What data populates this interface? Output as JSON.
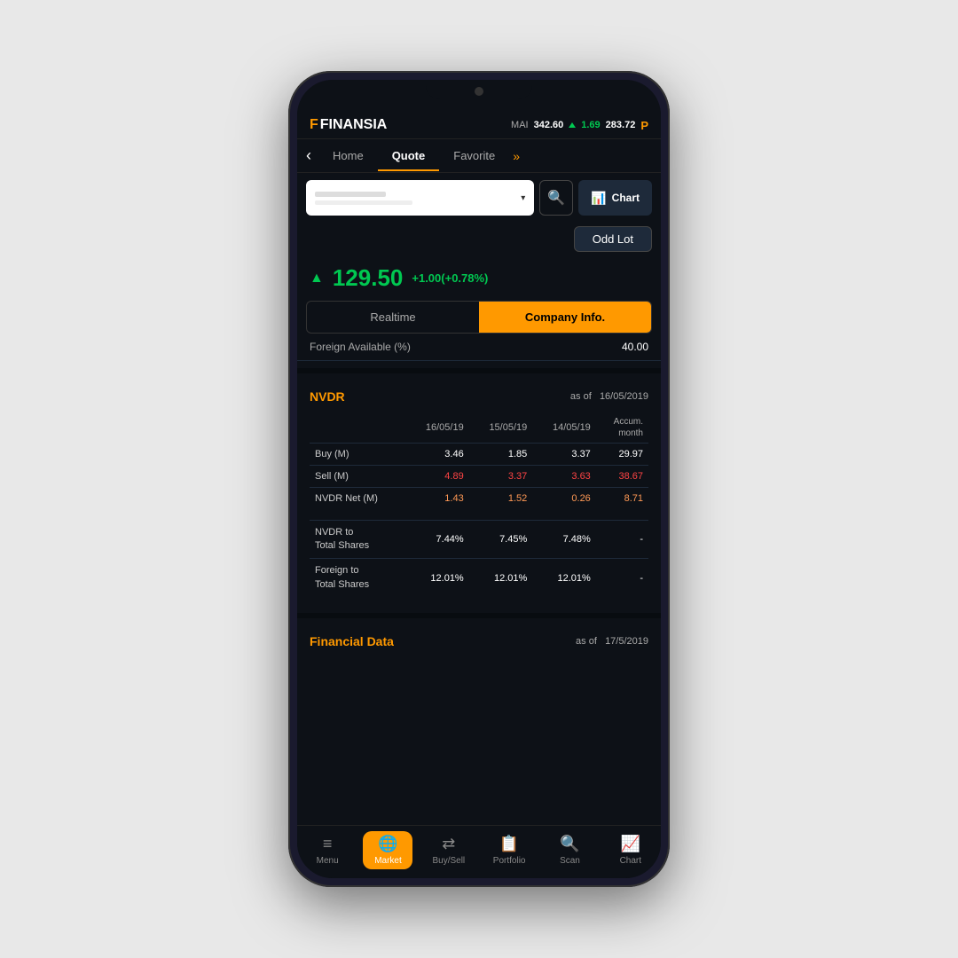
{
  "app": {
    "logo": "FINANSIA",
    "logo_f": "F"
  },
  "market_info": {
    "label": "MAI",
    "value": "342.60",
    "change": "1.69",
    "second_value": "283.72",
    "profile_letter": "P"
  },
  "nav": {
    "back_label": "‹",
    "tabs": [
      {
        "id": "home",
        "label": "Home",
        "active": false
      },
      {
        "id": "quote",
        "label": "Quote",
        "active": true
      },
      {
        "id": "favorite",
        "label": "Favorite",
        "active": false
      }
    ],
    "more_icon": "»"
  },
  "search": {
    "placeholder_line1": "...",
    "placeholder_line2": "...",
    "dropdown_arrow": "▾",
    "search_icon": "🔍",
    "chart_btn_label": "Chart"
  },
  "odd_lot": {
    "label": "Odd Lot"
  },
  "price": {
    "arrow": "▲",
    "value": "129.50",
    "change": "+1.00(+0.78%)"
  },
  "info_tabs": [
    {
      "id": "realtime",
      "label": "Realtime",
      "active": false
    },
    {
      "id": "company",
      "label": "Company Info.",
      "active": true
    }
  ],
  "foreign_available": {
    "label": "Foreign Available (%)",
    "value": "40.00"
  },
  "nvdr": {
    "title": "NVDR",
    "as_of_label": "as of",
    "date": "16/05/2019",
    "columns": [
      "",
      "16/05/19",
      "15/05/19",
      "14/05/19",
      "Accum. month"
    ],
    "rows": [
      {
        "label": "Buy (M)",
        "values": [
          "3.46",
          "1.85",
          "3.37",
          "29.97"
        ],
        "type": "buy"
      },
      {
        "label": "Sell (M)",
        "values": [
          "4.89",
          "3.37",
          "3.63",
          "38.67"
        ],
        "type": "sell"
      },
      {
        "label": "NVDR Net (M)",
        "values": [
          "1.43",
          "1.52",
          "0.26",
          "8.71"
        ],
        "type": "net"
      }
    ],
    "ratio_rows": [
      {
        "label": "NVDR to Total Shares",
        "values": [
          "7.44%",
          "7.45%",
          "7.48%",
          "-"
        ]
      },
      {
        "label": "Foreign to Total Shares",
        "values": [
          "12.01%",
          "12.01%",
          "12.01%",
          "-"
        ]
      }
    ]
  },
  "financial": {
    "title": "Financial Data",
    "as_of_label": "as of",
    "date": "17/5/2019"
  },
  "bottom_nav": [
    {
      "id": "menu",
      "icon": "≡",
      "label": "Menu",
      "active": false
    },
    {
      "id": "market",
      "icon": "🌐",
      "label": "Market",
      "active": true
    },
    {
      "id": "buysell",
      "icon": "⇄",
      "label": "Buy/Sell",
      "active": false
    },
    {
      "id": "portfolio",
      "icon": "📋",
      "label": "Portfolio",
      "active": false
    },
    {
      "id": "scan",
      "icon": "🔍",
      "label": "Scan",
      "active": false
    },
    {
      "id": "chart",
      "icon": "📈",
      "label": "Chart",
      "active": false
    }
  ]
}
